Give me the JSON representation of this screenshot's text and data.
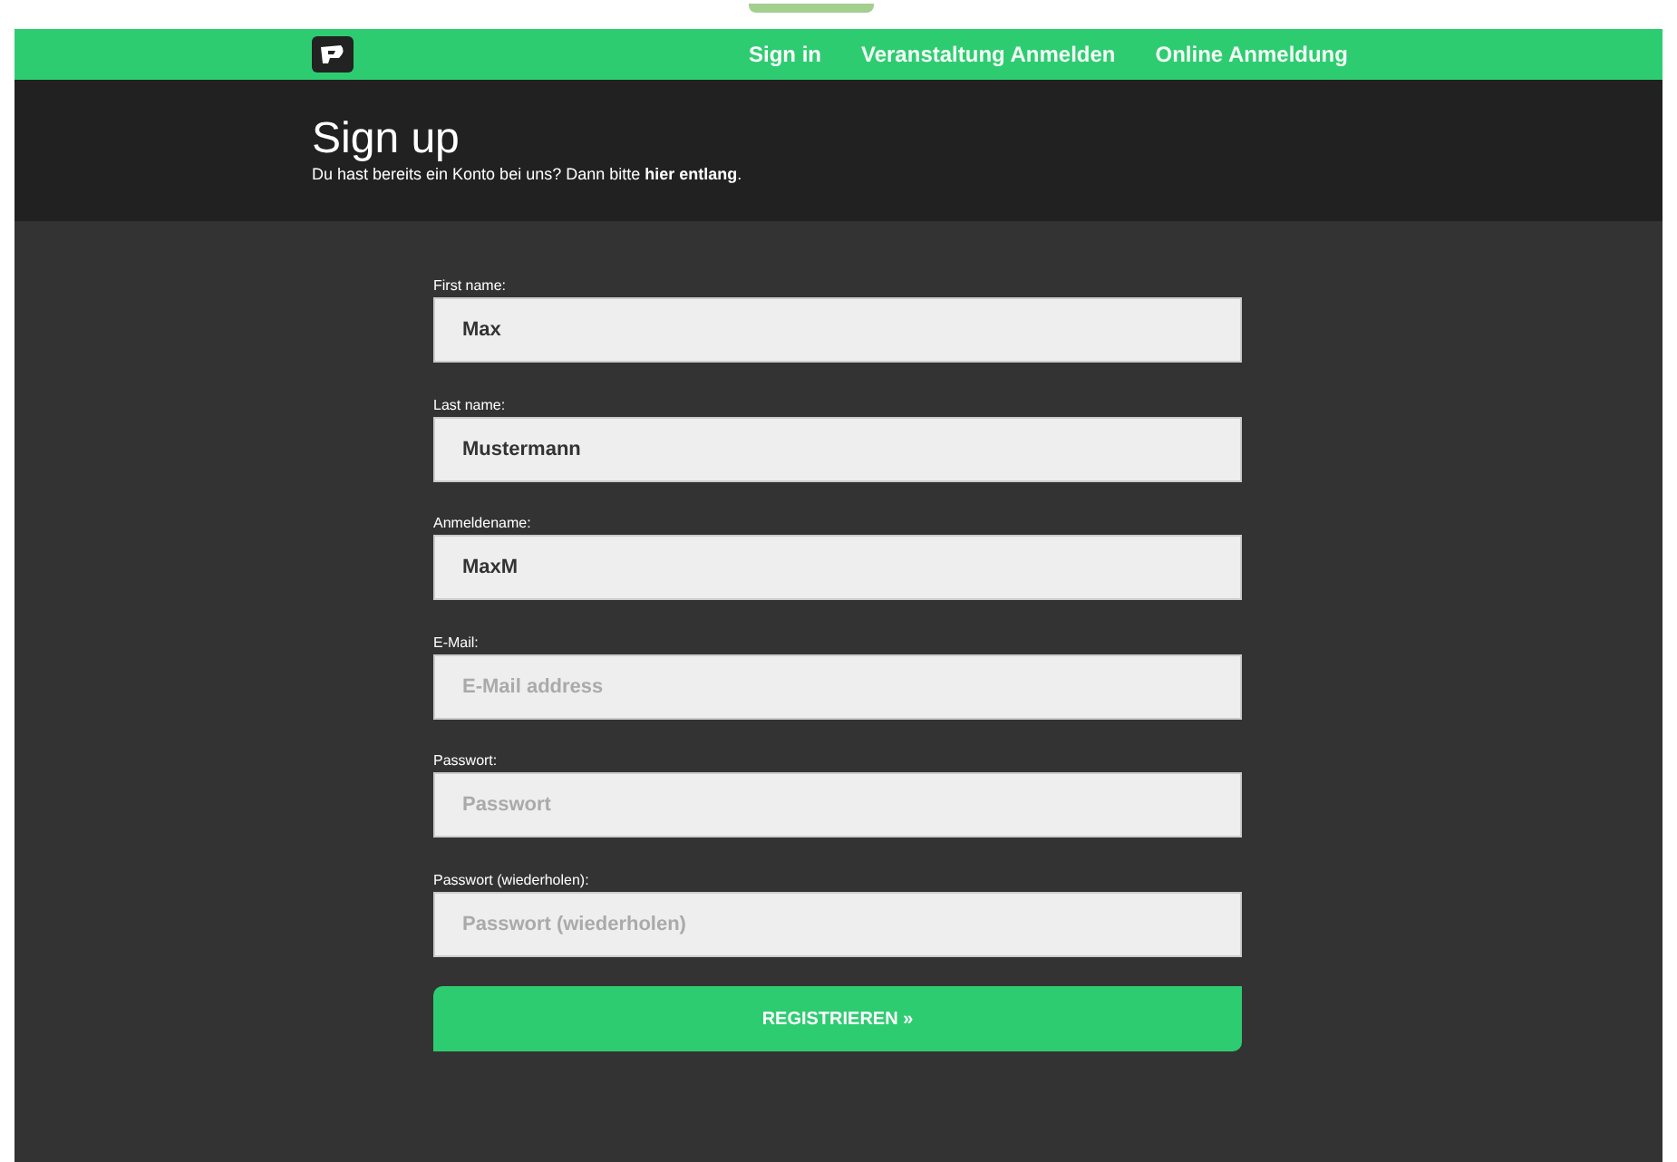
{
  "nav": {
    "items": [
      {
        "label": "Sign in",
        "selected": true
      },
      {
        "label": "Veranstaltung Anmelden",
        "selected": false
      },
      {
        "label": "Online Anmeldung",
        "selected": false
      }
    ]
  },
  "header": {
    "title": "Sign up",
    "subtitle": "Du hast bereits ein Konto bei uns? Dann bitte **hier entlang**."
  },
  "form": {
    "fields": [
      {
        "label": "First name:",
        "value": "Max"
      },
      {
        "label": "Last name:",
        "value": "Mustermann"
      },
      {
        "label": "Anmeldename:",
        "value": "MaxM"
      },
      {
        "label": "E-Mail:",
        "placeholder": "E-Mail address"
      },
      {
        "label": "Passwort:",
        "placeholder": "Passwort"
      },
      {
        "label": "Passwort (wiederholen):",
        "placeholder": "Passwort (wiederholen)"
      }
    ],
    "submit": "REGISTRIEREN »"
  }
}
